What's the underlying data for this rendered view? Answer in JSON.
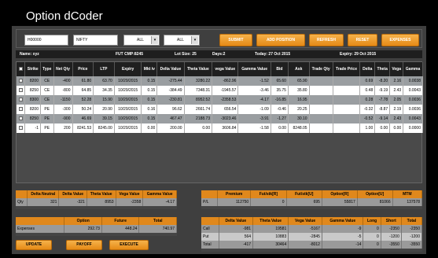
{
  "app": {
    "title": "Option dCoder"
  },
  "toolbar": {
    "account": "H00000",
    "symbol": "NIFTY",
    "filter1": "ALL",
    "filter2": "ALL",
    "buttons": [
      "SUBMIT",
      "ADD POSITION",
      "REFRESH",
      "RESET",
      "EXPENSES"
    ]
  },
  "info": {
    "name": "Name: xyz",
    "fut_cmp": "FUT CMP:8245",
    "lot_size": "Lot Size: 25",
    "days": "Days:2",
    "today": "Today: 27 Oct 2015",
    "expiry": "Expiry: 29 Oct 2015"
  },
  "positions": {
    "columns": [
      "",
      "Strike",
      "Type",
      "Net Qty",
      "Price",
      "LTP",
      "Expiry",
      "Mkt iv",
      "Delta Value",
      "Theta Value",
      "vega Value",
      "Gamma Value",
      "Bid",
      "Ask",
      "Trade Qty",
      "Trade Price",
      "Delta",
      "Theta",
      "Vega",
      "Gamma"
    ],
    "rows": [
      [
        "8200",
        "CE",
        "-400",
        "61.80",
        "63.70",
        "10/29/2015",
        "0.15",
        "-275.44",
        "3280.22",
        "-862.96",
        "-1.52",
        "65.60",
        "65.90",
        "",
        "",
        "0.69",
        "-8.20",
        "2.16",
        "0.0038"
      ],
      [
        "8250",
        "CE",
        "-800",
        "64.85",
        "34.35",
        "10/29/2015",
        "0.15",
        "-384.49",
        "7348.31",
        "-1945.57",
        "-3.46",
        "35.75",
        "35.80",
        "",
        "",
        "0.48",
        "-9.19",
        "2.43",
        "0.0043"
      ],
      [
        "8300",
        "CE",
        "-1150",
        "52.28",
        "15.90",
        "10/29/2015",
        "0.15",
        "-230.81",
        "8952.52",
        "-2358.53",
        "-4.17",
        "-16.85",
        "16.95",
        "",
        "",
        "0.28",
        "-7.78",
        "2.05",
        "0.0036"
      ],
      [
        "8200",
        "PE",
        "-300",
        "50.24",
        "20.90",
        "10/29/2015",
        "0.16",
        "96.62",
        "2661.74",
        "656.54",
        "-1.09",
        "-0.46",
        "20.25",
        "",
        "",
        "-0.32",
        "-8.87",
        "2.19",
        "0.0036"
      ],
      [
        "8250",
        "PE",
        "-900",
        "46.69",
        "39.15",
        "10/29/2015",
        "0.15",
        "467.47",
        "2188.73",
        "-3023.46",
        "-3.91",
        "-1.27",
        "30.10",
        "",
        "",
        "-0.52",
        "-9.14",
        "2.43",
        "0.0043"
      ],
      [
        "-1",
        "PE",
        "200",
        "8241.53",
        "8245.00",
        "10/29/2015",
        "0.00",
        "200.00",
        "0.00",
        "3606.84",
        "-1.58",
        "0.00",
        "8248.05",
        "",
        "",
        "1.00",
        "0.00",
        "0.00",
        "0.0000"
      ]
    ]
  },
  "greeks_summary": {
    "headers": [
      "",
      "Delta Neutral",
      "Delta Value",
      "Theta Value",
      "Vega Value",
      "Gamma Value"
    ],
    "row": [
      "Qty",
      "321",
      "-321",
      "8953",
      "-2358",
      "-4.17"
    ]
  },
  "expenses": {
    "headers": [
      "",
      "Option",
      "Future",
      "Total"
    ],
    "row": [
      "Expenses",
      "292.73",
      "448.24",
      "740.97"
    ]
  },
  "bottom_buttons": [
    "UPDATE",
    "PAYOFF",
    "EXECUTE"
  ],
  "pnl": {
    "headers": [
      "",
      "Premium",
      "Fut/stk[R]",
      "Fut/stk[U]",
      "Option[R]",
      "Option[U]",
      "MTM"
    ],
    "row": [
      "P/L",
      "112750",
      "0",
      "695",
      "55817",
      "81066",
      "137578"
    ]
  },
  "call_put": {
    "headers": [
      "",
      "Delta Value",
      "Theta Value",
      "Vega Value",
      "Gamma Value",
      "Long",
      "Short",
      "Total"
    ],
    "rows": [
      [
        "Call",
        "-981",
        "19581",
        "-5167",
        "-9",
        "0",
        "-2350",
        "-2350"
      ],
      [
        "Put",
        "564",
        "10883",
        "-2845",
        "-5",
        "0",
        "-1200",
        "-1200"
      ],
      [
        "Total",
        "-417",
        "30464",
        "-8012",
        "-14",
        "0",
        "-3550",
        "-3550"
      ]
    ]
  },
  "colors": {
    "accent": "#e58a17",
    "background": "#000000",
    "panel": "#3f3f3f"
  }
}
